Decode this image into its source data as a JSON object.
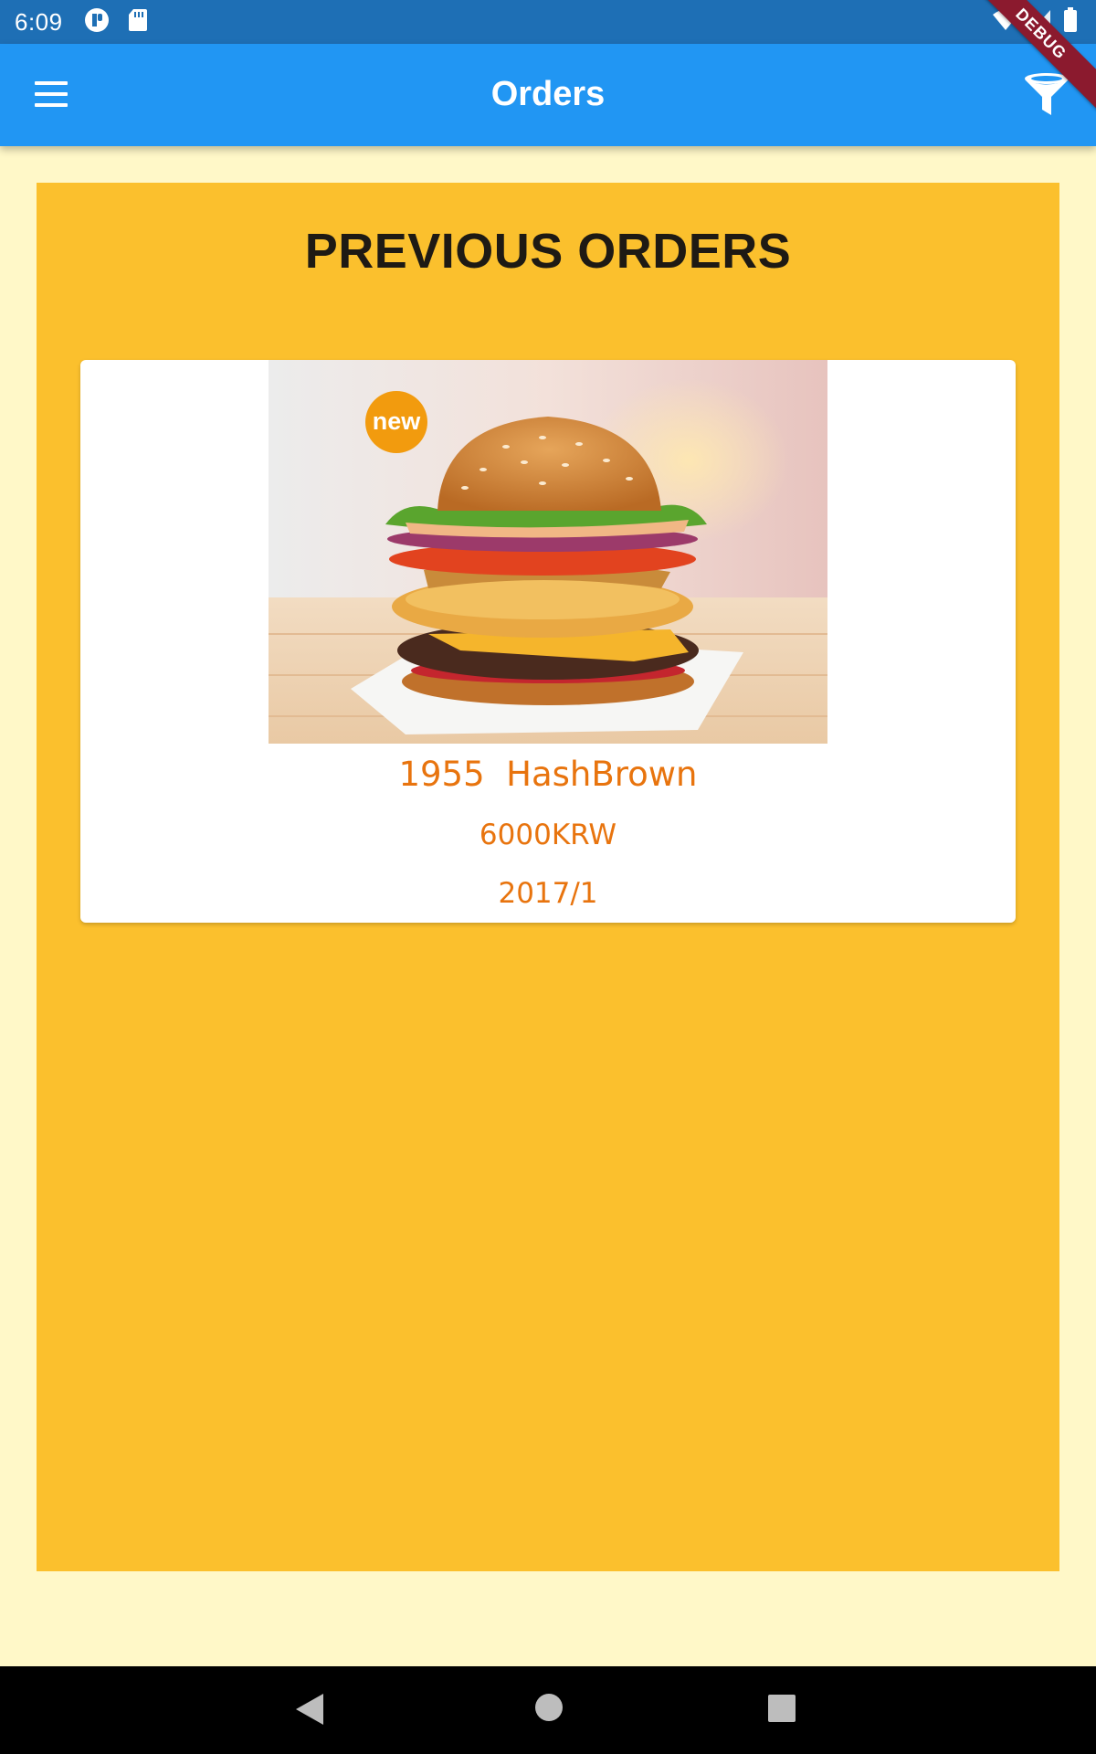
{
  "status_bar": {
    "time": "6:09",
    "left_icons": [
      "cast-icon",
      "sd-card-icon"
    ],
    "right_icons": [
      "wifi-icon",
      "signal-icon",
      "battery-icon"
    ]
  },
  "debug_banner": "DEBUG",
  "app_bar": {
    "title": "Orders",
    "leading_icon": "menu-icon",
    "trailing_icon": "filter-icon",
    "color": "#2196F3"
  },
  "main": {
    "heading": "PREVIOUS ORDERS",
    "background_color": "#FBC02D",
    "orders": [
      {
        "image_description_icon": "burger-image",
        "badge": "new",
        "name": "1955  HashBrown",
        "price": "6000KRW",
        "date": "2017/1"
      }
    ]
  },
  "nav_bar": {
    "items": [
      "back-icon",
      "home-icon",
      "recents-icon"
    ]
  }
}
